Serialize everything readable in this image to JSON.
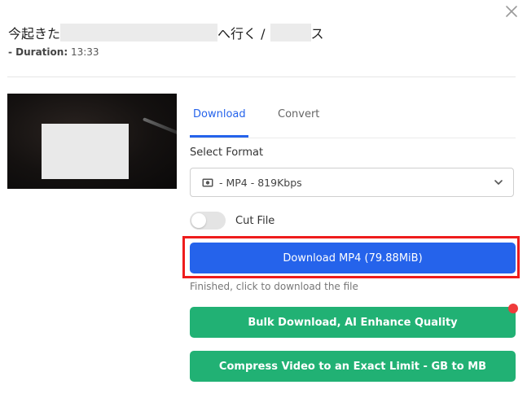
{
  "header": {
    "title_start": "今起きた",
    "title_mid": "へ行く / ",
    "title_small": "ス",
    "duration_label": "- Duration:",
    "duration_value": "13:33"
  },
  "tabs": [
    {
      "label": "Download",
      "active": true
    },
    {
      "label": "Convert",
      "active": false
    }
  ],
  "format": {
    "label": "Select Format",
    "selected": "- MP4 - 819Kbps"
  },
  "cut": {
    "label": "Cut File",
    "enabled": false
  },
  "download_button": {
    "label": "Download MP4 (79.88MiB)"
  },
  "status_text": "Finished, click to download the file",
  "bulk_button": {
    "label": "Bulk Download, AI Enhance Quality"
  },
  "compress_button": {
    "label": "Compress Video to an Exact Limit - GB to MB"
  },
  "colors": {
    "accent": "#2563eb",
    "green": "#21b174",
    "highlight": "#ee1c1c",
    "notification": "#ef3b3b"
  },
  "icons": {
    "close": "close-icon",
    "video": "video-icon",
    "chevron": "chevron-down-icon"
  }
}
